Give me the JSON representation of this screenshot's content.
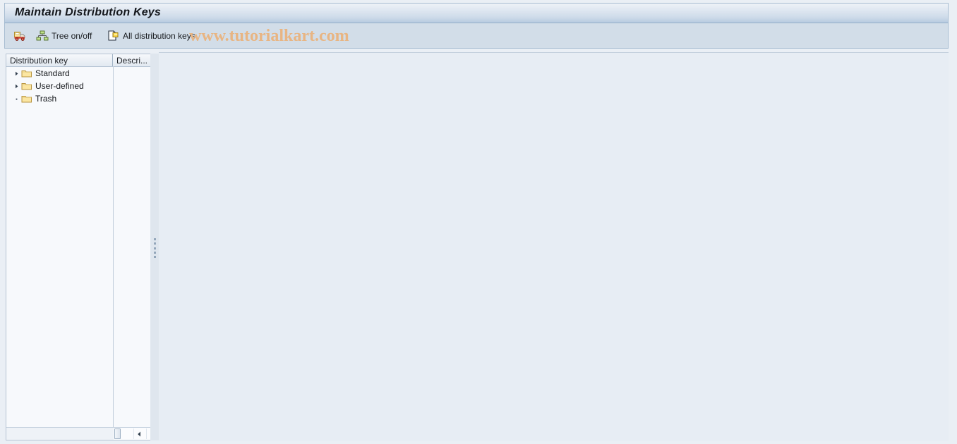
{
  "window": {
    "title": "Maintain Distribution Keys"
  },
  "toolbar": {
    "items": [
      {
        "label": "",
        "icon": "truck-icon",
        "name": "delivery-truck-button"
      },
      {
        "label": "Tree on/off",
        "icon": "hierarchy-tree-icon",
        "name": "tree-on-off-button"
      },
      {
        "label": "All distribution keys",
        "icon": "copy-documents-icon",
        "name": "all-distribution-keys-button"
      }
    ]
  },
  "watermark": {
    "text": "www.tutorialkart.com",
    "color": "#e8b583"
  },
  "tree": {
    "columns": [
      {
        "label": "Distribution key",
        "name": "column-distribution-key"
      },
      {
        "label": "Descri...",
        "name": "column-description"
      }
    ],
    "rows": [
      {
        "label": "Standard",
        "state": "collapsed",
        "icon": "folder-icon"
      },
      {
        "label": "User-defined",
        "state": "collapsed",
        "icon": "folder-icon"
      },
      {
        "label": "Trash",
        "state": "leaf",
        "icon": "folder-icon"
      }
    ],
    "scrollbar": {
      "left_arrow": "scroll-left-icon",
      "right_arrow": "scroll-right-icon"
    }
  },
  "colors": {
    "title_bar_top": "#eef2f7",
    "title_bar_bottom": "#b8cbe0",
    "toolbar_bg": "#d2dde8",
    "tree_bg": "#f7f9fc",
    "content_bg": "#e7edf4",
    "folder_fill": "#fbe6a2",
    "folder_edge": "#b99540"
  }
}
